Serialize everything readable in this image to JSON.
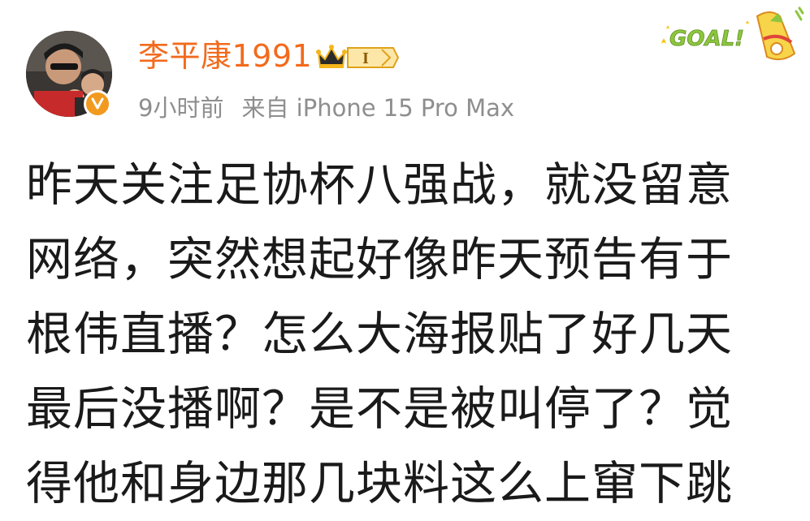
{
  "post": {
    "username": "李平康1991",
    "time": "9小时前",
    "source": "来自 iPhone 15 Pro Max",
    "badge_level": "I",
    "sticker_text": "GOAL!",
    "lines": [
      "昨天关注足协杯八强战，就没留意",
      "网络，突然想起好像昨天预告有于",
      "根伟直播？怎么大海报贴了好几天",
      "最后没播啊？是不是被叫停了？觉",
      "得他和身边那几块料这么上窜下跳"
    ]
  },
  "colors": {
    "username": "#f26b1d",
    "meta": "#8e8e8e",
    "body_text": "#1a1a1a",
    "verified": "#f29a1f",
    "badge_gold": "#f5b51b",
    "sticker_green": "#8cc63f"
  },
  "icons": {
    "avatar": "user-avatar",
    "verified": "verified-badge-icon",
    "crown": "crown-level-badge-icon",
    "sticker": "goal-sticker-icon"
  }
}
